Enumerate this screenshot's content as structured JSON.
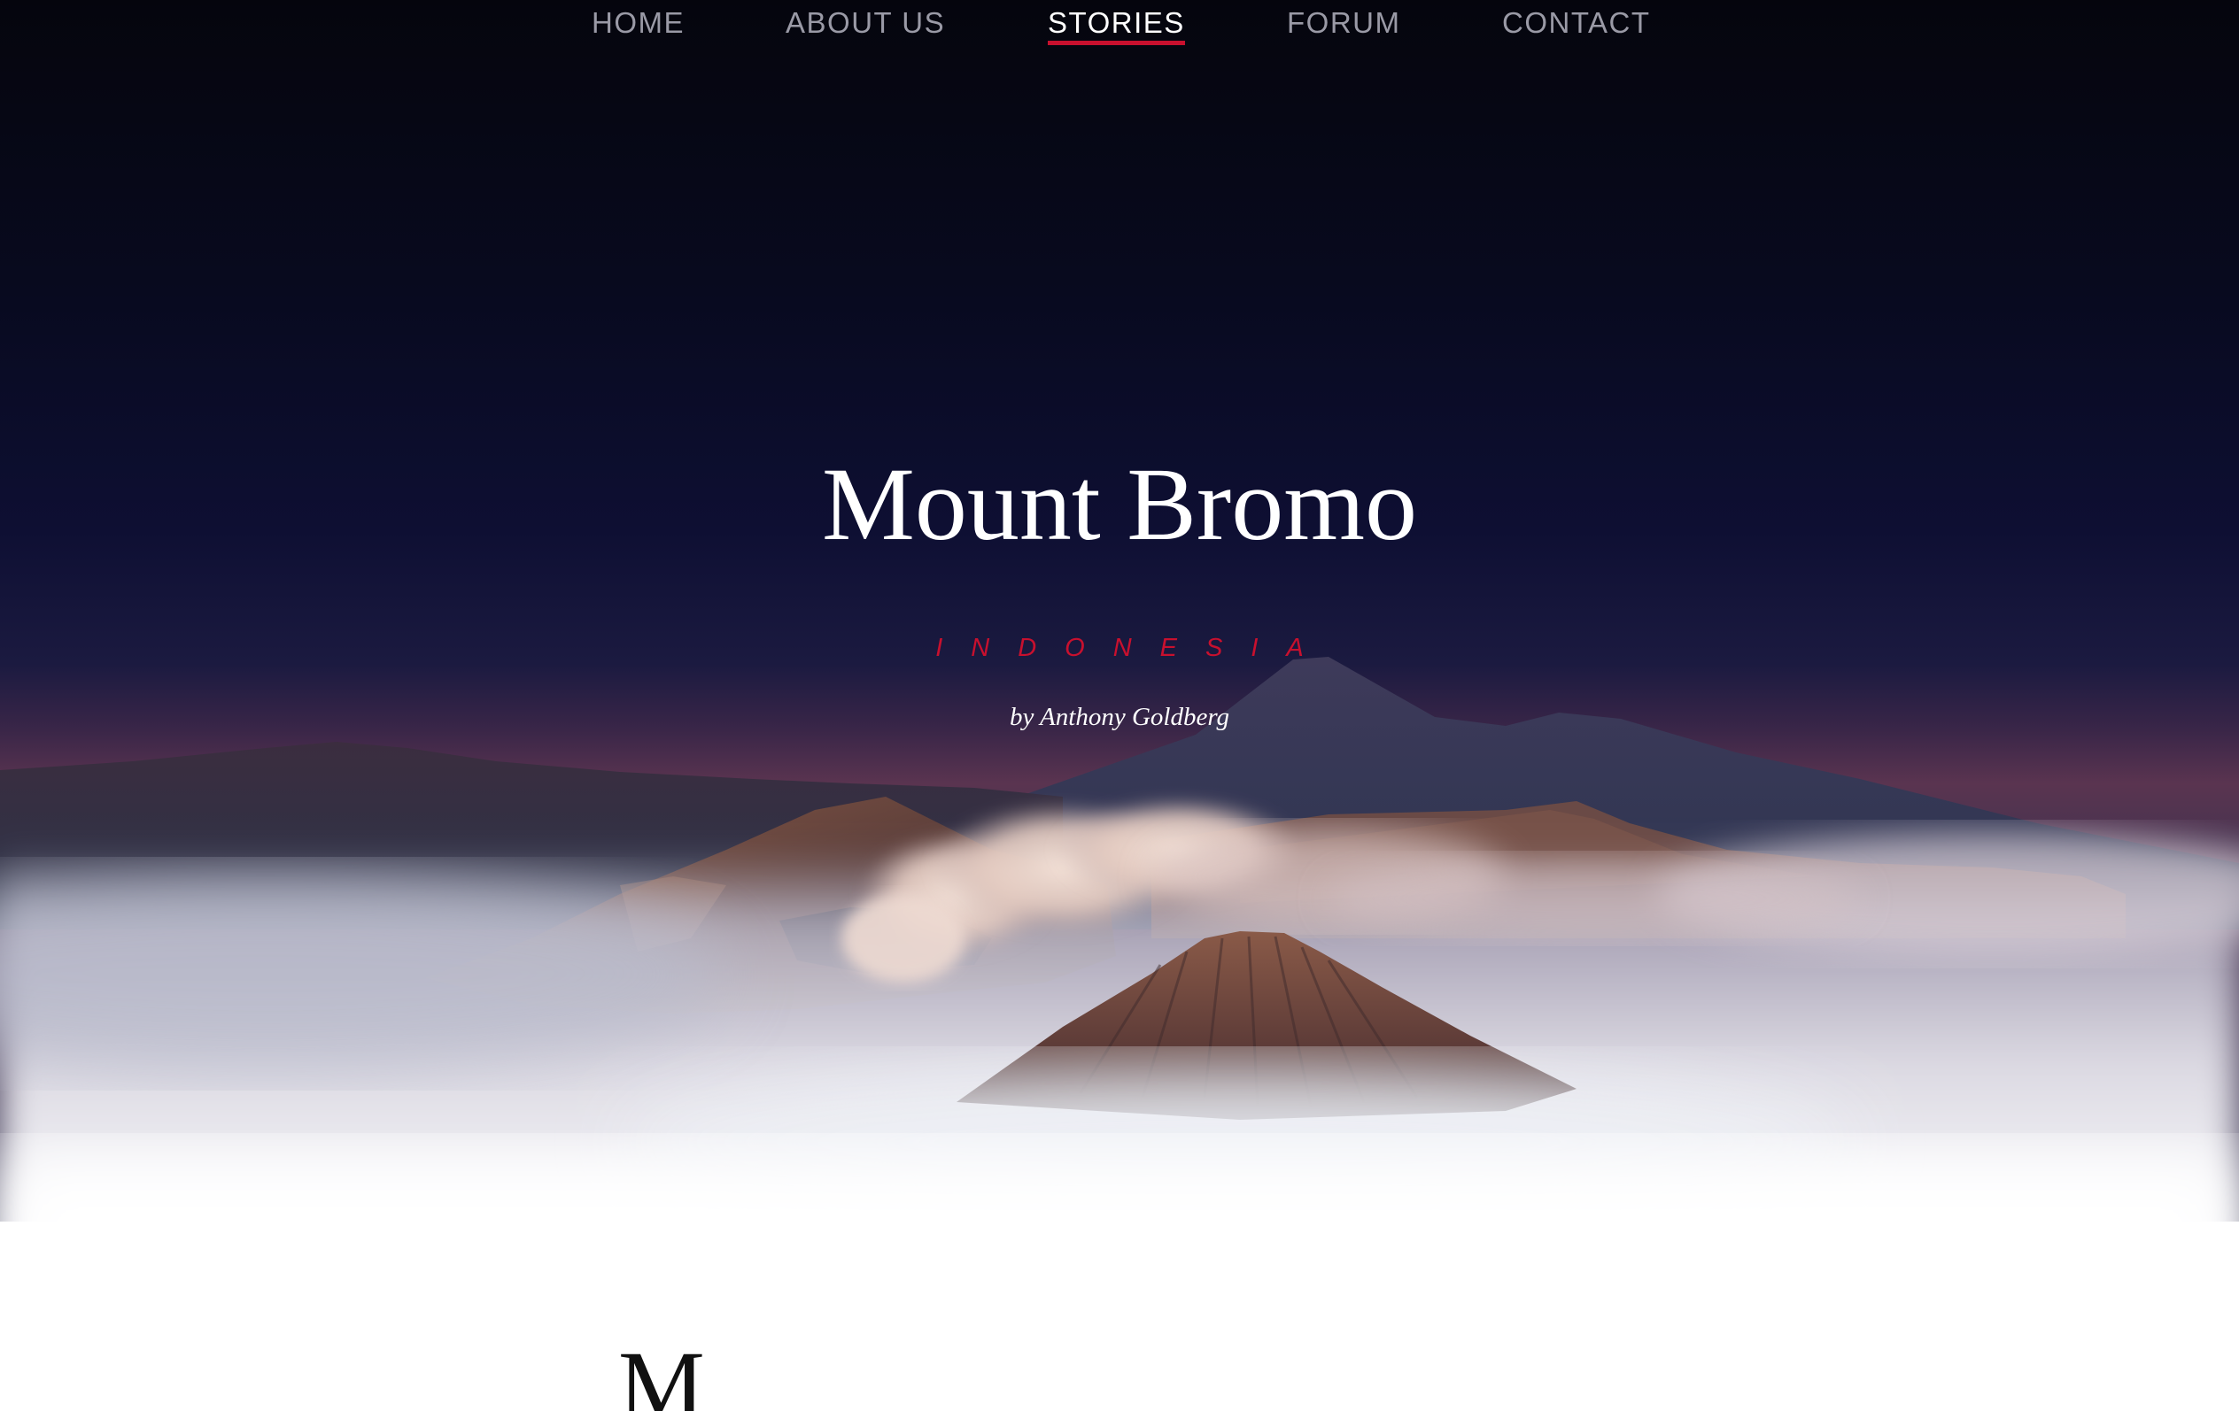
{
  "nav": {
    "items": [
      {
        "label": "HOME"
      },
      {
        "label": "ABOUT US"
      },
      {
        "label": "STORIES"
      },
      {
        "label": "FORUM"
      },
      {
        "label": "CONTACT"
      }
    ],
    "active": "STORIES"
  },
  "hero": {
    "title": "Mount Bromo",
    "subtitle": "INDONESIA",
    "byline": "by Anthony Goldberg"
  },
  "article": {
    "drop_cap": "M"
  },
  "colors": {
    "accent": "#c8102e",
    "sky_top": "#05050d",
    "sky_mid": "#0c0c2c",
    "nav_inactive": "#9a9aa6"
  }
}
